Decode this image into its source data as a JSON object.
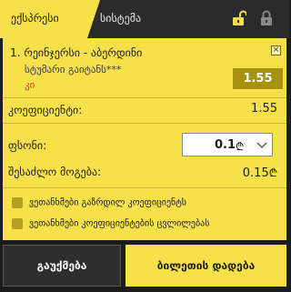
{
  "tabs": {
    "express": "ექსპრესი",
    "system": "სისტემა"
  },
  "bet": {
    "index_title": "1. რეინჯერსი - აბერდინი",
    "market": "სტუმარი გაიტანს***",
    "type": "კი",
    "odds": "1.55",
    "close_symbol": "×"
  },
  "summary": {
    "coefficient_label": "კოეფიციენტი:",
    "coefficient_value": "1.55",
    "stake_label": "ფსონი:",
    "stake_value": "0.1",
    "currency_symbol": "₾",
    "possible_win_label": "შესაძლო მოგება:",
    "possible_win_value": "0.15"
  },
  "options": {
    "accept_higher": "ვეთანხმები გაზრდილ კოეფიციენტს",
    "accept_changes": "ვეთანხმები კოეფიციენტების ცვლილებას"
  },
  "buttons": {
    "cancel": "გაუქმება",
    "place": "ბილეთის დადება"
  },
  "colors": {
    "accent": "#f7e14b",
    "odds_bg": "#a6920c",
    "dark": "#2b2b2b"
  },
  "icons": [
    "lock-open-icon",
    "lock-closed-icon",
    "close-icon",
    "chevron-down-icon"
  ]
}
